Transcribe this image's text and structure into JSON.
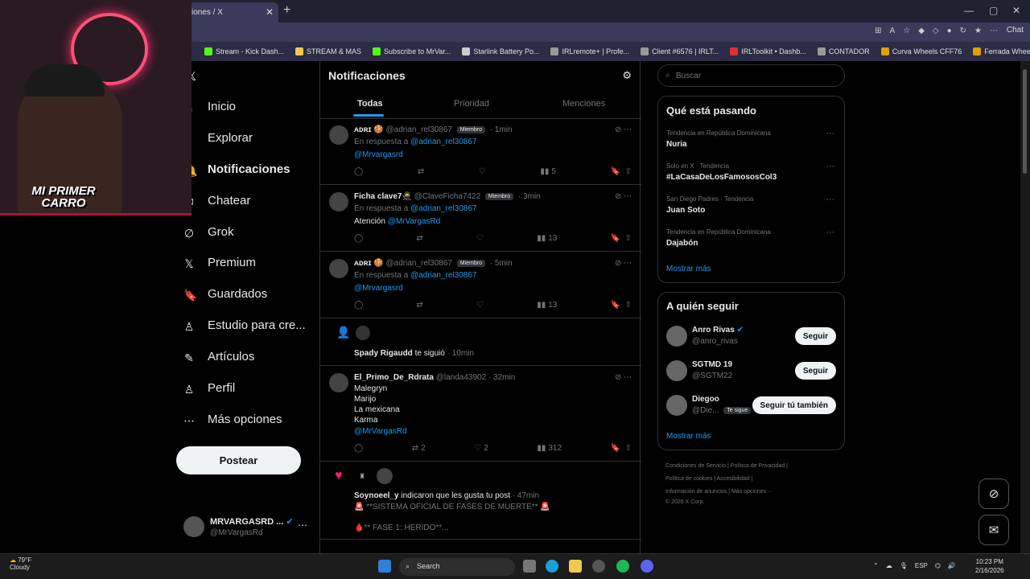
{
  "browser": {
    "tab_title": "iones / X",
    "tab_close": "✕",
    "new_tab": "+",
    "chat_label": "Chat",
    "bookmarks": [
      {
        "label": "Stream - Kick Dash...",
        "color": "#53fc18"
      },
      {
        "label": "STREAM & MAS",
        "color": "#f2c94c"
      },
      {
        "label": "Subscribe to MrVar...",
        "color": "#53fc18"
      },
      {
        "label": "Starlink Battery Po...",
        "color": "#cccccc"
      },
      {
        "label": "IRLremote+ | Profe...",
        "color": "#999999"
      },
      {
        "label": "Client #6576 | IRLT...",
        "color": "#999999"
      },
      {
        "label": "IRLToolkit • Dashb...",
        "color": "#e03030"
      },
      {
        "label": "CONTADOR",
        "color": "#999999"
      },
      {
        "label": "Curva Wheels CFF76",
        "color": "#e0a000"
      },
      {
        "label": "Ferrada Wheels FR9",
        "color": "#e0a000"
      }
    ]
  },
  "webcam": {
    "overlay_text_1": "MI PRIMER",
    "overlay_text_2": "CARRO"
  },
  "nav": {
    "items": [
      {
        "label": "Inicio",
        "icon": "⌂"
      },
      {
        "label": "Explorar",
        "icon": "⌕"
      },
      {
        "label": "Notificaciones",
        "icon": "🔔"
      },
      {
        "label": "Chatear",
        "icon": "✉"
      },
      {
        "label": "Grok",
        "icon": "∅"
      },
      {
        "label": "Premium",
        "icon": "𝕏"
      },
      {
        "label": "Guardados",
        "icon": "🔖"
      },
      {
        "label": "Estudio para cre...",
        "icon": "♙"
      },
      {
        "label": "Artículos",
        "icon": "✎"
      },
      {
        "label": "Perfil",
        "icon": "♙"
      },
      {
        "label": "Más opciones",
        "icon": "⋯"
      }
    ],
    "post_label": "Postear",
    "profile_name": "MRVARGASRD ...",
    "profile_handle": "@MrVargasRd"
  },
  "notifications": {
    "header": "Notificaciones",
    "tabs": [
      "Todas",
      "Prioridad",
      "Menciones"
    ],
    "items": [
      {
        "name": "ᴀᴅʀɪ 🍪",
        "handle": "@adrian_rel30867",
        "badge": "Miembro",
        "time": "· 1min",
        "reply_prefix": "En respuesta a",
        "reply_to": "@adrian_rel30867",
        "body": "@Mrvargasrd",
        "views": "5"
      },
      {
        "name": "Ficha clave7🥷",
        "handle": "@ClaveFicha7422",
        "badge": "Miembro",
        "time": "· 3min",
        "reply_prefix": "En respuesta a",
        "reply_to": "@adrian_rel30867",
        "body_text": "Atención",
        "body": "@MrVargasRd",
        "views": "13"
      },
      {
        "name": "ᴀᴅʀɪ 🍪",
        "handle": "@adrian_rel30867",
        "badge": "Miembro",
        "time": "· 5min",
        "reply_prefix": "En respuesta a",
        "reply_to": "@adrian_rel30867",
        "body": "@Mrvargasrd",
        "views": "13"
      }
    ],
    "follow_notice": {
      "name": "Spady Rigaudd",
      "text": "te siguió",
      "time": "· 10min"
    },
    "long_post": {
      "name": "El_Primo_De_Rdrata",
      "handle": "@landa43902",
      "time": "· 32min",
      "lines": [
        "Malegryn",
        "Marijo",
        "La mexicana",
        "Karma"
      ],
      "mention": "@MrVargasRd",
      "retweets": "2",
      "likes": "2",
      "views": "312"
    },
    "like_notice": {
      "name": "Soynoeel_y",
      "text": "indicaron que les gusta tu post",
      "time": "· 47min",
      "line1": "🚨 **SISTEMA OFICIAL DE FASES DE MUERTE** 🚨",
      "line2": "🩸** FASE 1: HERIDO**..."
    }
  },
  "right": {
    "search_placeholder": "Buscar",
    "trending_title": "Qué está pasando",
    "trends": [
      {
        "context": "Tendencia en República Dominicana",
        "name": "Nuria"
      },
      {
        "context": "Solo en X · Tendencia",
        "name": "#LaCasaDeLosFamososCol3"
      },
      {
        "context": "San Diego Padres · Tendencia",
        "name": "Juan Soto"
      },
      {
        "context": "Tendencia en República Dominicana",
        "name": "Dajabón"
      }
    ],
    "show_more": "Mostrar más",
    "who_title": "A quién seguir",
    "who": [
      {
        "name": "Anro Rivas",
        "handle": "@anro_rivas",
        "button": "Seguir"
      },
      {
        "name": "SGTMD 19",
        "handle": "@SGTM22",
        "button": "Seguir"
      },
      {
        "name": "Diegoo",
        "handle": "@Die...",
        "tag": "Te sigue",
        "button": "Seguir tú también"
      }
    ],
    "footer_1": "Condiciones de Servicio  |  Política de Privacidad  |",
    "footer_2": "Política de cookies  |  Accesibilidad  |",
    "footer_3": "Información de anuncios  |  Más opciones ···",
    "footer_4": "© 2026 X Corp."
  },
  "taskbar": {
    "temp": "79°F",
    "weather": "Cloudy",
    "search": "Search",
    "lang": "ESP",
    "time": "10:23 PM",
    "date": "2/16/2026"
  }
}
